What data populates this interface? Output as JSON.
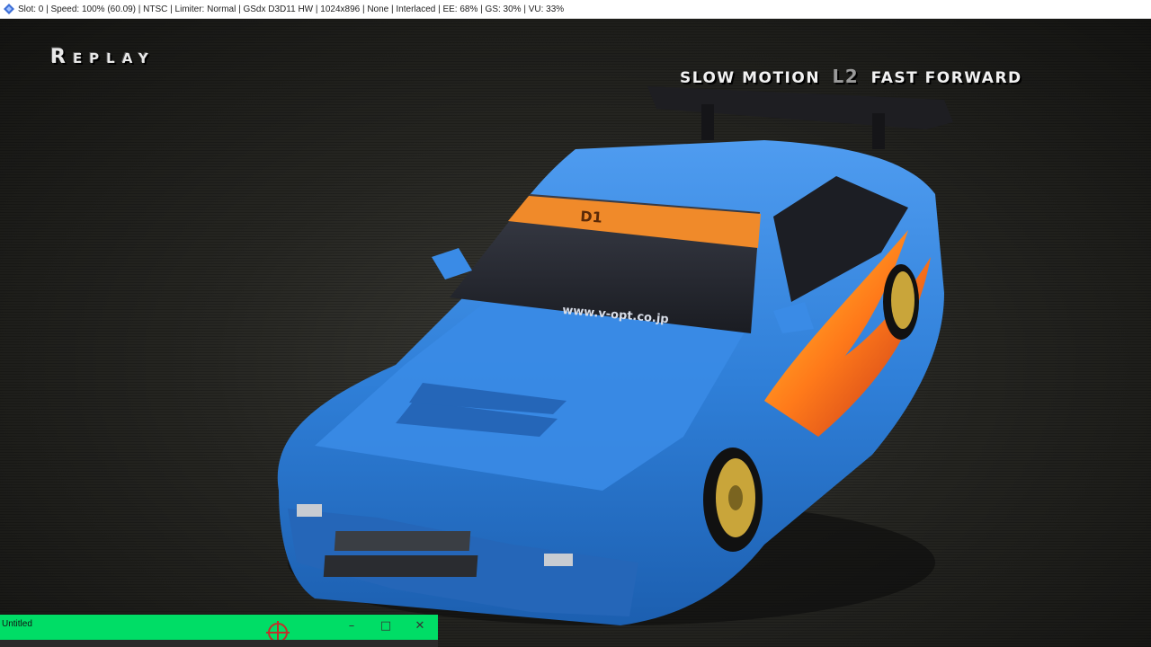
{
  "titlebar": {
    "app_icon": "pcsx2-diamond-icon",
    "text": "Slot: 0 | Speed: 100% (60.09) | NTSC | Limiter: Normal | GSdx D3D11 HW | 1024x896 | None | Interlaced | EE: 68% | GS: 30% | VU: 33%"
  },
  "game": {
    "replay_label": "Replay",
    "hint_left": "SLOW MOTION",
    "hint_button": "L2",
    "hint_right": "FAST FORWARD",
    "windshield_banner": "D1",
    "windshield_url": "www.v-opt.co.jp",
    "car_color": "#2f7fd8",
    "banner_color": "#f08a2a"
  },
  "mini_window": {
    "title": "Untitled",
    "minimize_icon": "minimize-icon",
    "maximize_icon": "maximize-icon",
    "close_icon": "close-icon",
    "crosshair_icon": "crosshair-icon",
    "bg_color": "#00dd66"
  }
}
